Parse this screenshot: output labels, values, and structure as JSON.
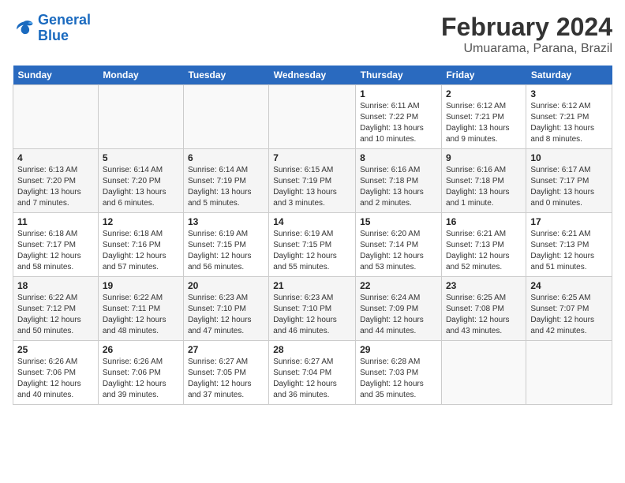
{
  "logo": {
    "text_general": "General",
    "text_blue": "Blue"
  },
  "title": "February 2024",
  "subtitle": "Umuarama, Parana, Brazil",
  "headers": [
    "Sunday",
    "Monday",
    "Tuesday",
    "Wednesday",
    "Thursday",
    "Friday",
    "Saturday"
  ],
  "weeks": [
    [
      {
        "day": "",
        "info": ""
      },
      {
        "day": "",
        "info": ""
      },
      {
        "day": "",
        "info": ""
      },
      {
        "day": "",
        "info": ""
      },
      {
        "day": "1",
        "info": "Sunrise: 6:11 AM\nSunset: 7:22 PM\nDaylight: 13 hours and 10 minutes."
      },
      {
        "day": "2",
        "info": "Sunrise: 6:12 AM\nSunset: 7:21 PM\nDaylight: 13 hours and 9 minutes."
      },
      {
        "day": "3",
        "info": "Sunrise: 6:12 AM\nSunset: 7:21 PM\nDaylight: 13 hours and 8 minutes."
      }
    ],
    [
      {
        "day": "4",
        "info": "Sunrise: 6:13 AM\nSunset: 7:20 PM\nDaylight: 13 hours and 7 minutes."
      },
      {
        "day": "5",
        "info": "Sunrise: 6:14 AM\nSunset: 7:20 PM\nDaylight: 13 hours and 6 minutes."
      },
      {
        "day": "6",
        "info": "Sunrise: 6:14 AM\nSunset: 7:19 PM\nDaylight: 13 hours and 5 minutes."
      },
      {
        "day": "7",
        "info": "Sunrise: 6:15 AM\nSunset: 7:19 PM\nDaylight: 13 hours and 3 minutes."
      },
      {
        "day": "8",
        "info": "Sunrise: 6:16 AM\nSunset: 7:18 PM\nDaylight: 13 hours and 2 minutes."
      },
      {
        "day": "9",
        "info": "Sunrise: 6:16 AM\nSunset: 7:18 PM\nDaylight: 13 hours and 1 minute."
      },
      {
        "day": "10",
        "info": "Sunrise: 6:17 AM\nSunset: 7:17 PM\nDaylight: 13 hours and 0 minutes."
      }
    ],
    [
      {
        "day": "11",
        "info": "Sunrise: 6:18 AM\nSunset: 7:17 PM\nDaylight: 12 hours and 58 minutes."
      },
      {
        "day": "12",
        "info": "Sunrise: 6:18 AM\nSunset: 7:16 PM\nDaylight: 12 hours and 57 minutes."
      },
      {
        "day": "13",
        "info": "Sunrise: 6:19 AM\nSunset: 7:15 PM\nDaylight: 12 hours and 56 minutes."
      },
      {
        "day": "14",
        "info": "Sunrise: 6:19 AM\nSunset: 7:15 PM\nDaylight: 12 hours and 55 minutes."
      },
      {
        "day": "15",
        "info": "Sunrise: 6:20 AM\nSunset: 7:14 PM\nDaylight: 12 hours and 53 minutes."
      },
      {
        "day": "16",
        "info": "Sunrise: 6:21 AM\nSunset: 7:13 PM\nDaylight: 12 hours and 52 minutes."
      },
      {
        "day": "17",
        "info": "Sunrise: 6:21 AM\nSunset: 7:13 PM\nDaylight: 12 hours and 51 minutes."
      }
    ],
    [
      {
        "day": "18",
        "info": "Sunrise: 6:22 AM\nSunset: 7:12 PM\nDaylight: 12 hours and 50 minutes."
      },
      {
        "day": "19",
        "info": "Sunrise: 6:22 AM\nSunset: 7:11 PM\nDaylight: 12 hours and 48 minutes."
      },
      {
        "day": "20",
        "info": "Sunrise: 6:23 AM\nSunset: 7:10 PM\nDaylight: 12 hours and 47 minutes."
      },
      {
        "day": "21",
        "info": "Sunrise: 6:23 AM\nSunset: 7:10 PM\nDaylight: 12 hours and 46 minutes."
      },
      {
        "day": "22",
        "info": "Sunrise: 6:24 AM\nSunset: 7:09 PM\nDaylight: 12 hours and 44 minutes."
      },
      {
        "day": "23",
        "info": "Sunrise: 6:25 AM\nSunset: 7:08 PM\nDaylight: 12 hours and 43 minutes."
      },
      {
        "day": "24",
        "info": "Sunrise: 6:25 AM\nSunset: 7:07 PM\nDaylight: 12 hours and 42 minutes."
      }
    ],
    [
      {
        "day": "25",
        "info": "Sunrise: 6:26 AM\nSunset: 7:06 PM\nDaylight: 12 hours and 40 minutes."
      },
      {
        "day": "26",
        "info": "Sunrise: 6:26 AM\nSunset: 7:06 PM\nDaylight: 12 hours and 39 minutes."
      },
      {
        "day": "27",
        "info": "Sunrise: 6:27 AM\nSunset: 7:05 PM\nDaylight: 12 hours and 37 minutes."
      },
      {
        "day": "28",
        "info": "Sunrise: 6:27 AM\nSunset: 7:04 PM\nDaylight: 12 hours and 36 minutes."
      },
      {
        "day": "29",
        "info": "Sunrise: 6:28 AM\nSunset: 7:03 PM\nDaylight: 12 hours and 35 minutes."
      },
      {
        "day": "",
        "info": ""
      },
      {
        "day": "",
        "info": ""
      }
    ]
  ]
}
